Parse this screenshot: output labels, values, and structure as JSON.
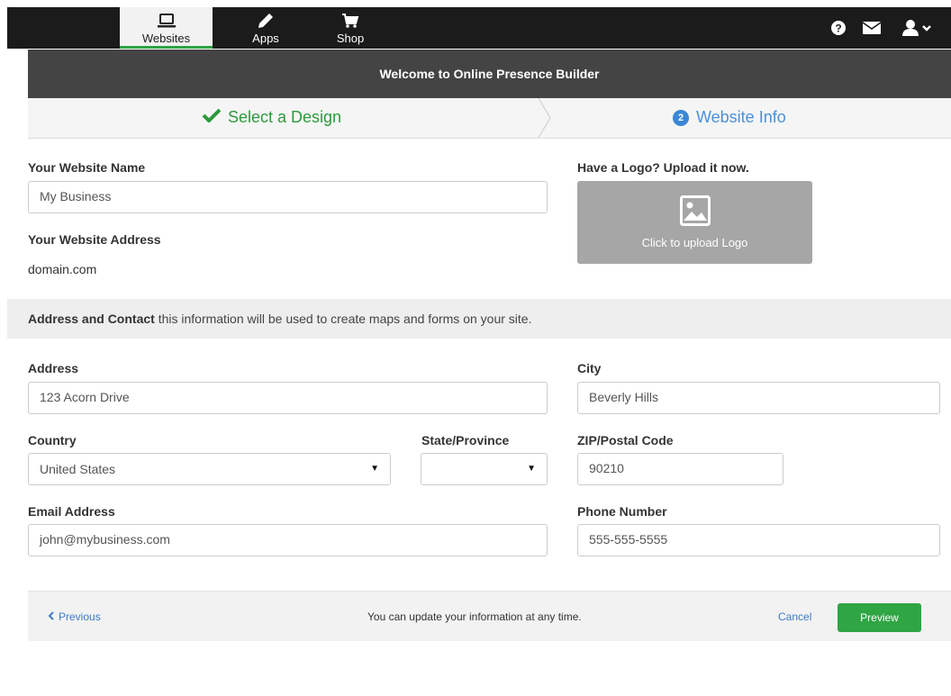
{
  "nav": {
    "websites_label": "Websites",
    "apps_label": "Apps",
    "shop_label": "Shop",
    "accent_color": "#2fa544"
  },
  "header": {
    "title": "Welcome to Online Presence Builder"
  },
  "steps": {
    "step1_label": "Select a Design",
    "step2_number": "2",
    "step2_label": "Website Info"
  },
  "site": {
    "name_label": "Your Website Name",
    "name_value": "My Business",
    "address_label": "Your Website Address",
    "address_value": "domain.com",
    "logo_label": "Have a Logo? Upload it now.",
    "logo_button": "Click to upload Logo"
  },
  "section": {
    "title": "Address and Contact",
    "description": " this information will be used to create maps and forms on your site."
  },
  "contact": {
    "address_label": "Address",
    "address_value": "123 Acorn Drive",
    "city_label": "City",
    "city_value": "Beverly Hills",
    "country_label": "Country",
    "country_value": "United States",
    "state_label": "State/Province",
    "state_value": "",
    "zip_label": "ZIP/Postal Code",
    "zip_value": "90210",
    "email_label": "Email Address",
    "email_value": "john@mybusiness.com",
    "phone_label": "Phone Number",
    "phone_value": "555-555-5555"
  },
  "footer": {
    "previous_label": "Previous",
    "message": "You can update your information at any time.",
    "cancel_label": "Cancel",
    "preview_label": "Preview"
  }
}
